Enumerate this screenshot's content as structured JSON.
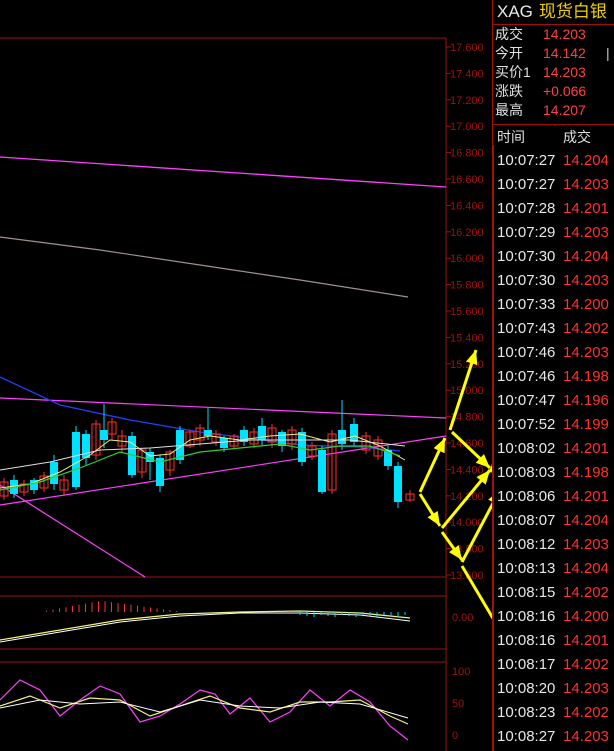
{
  "price_axis": [
    "17.600",
    "17.400",
    "17.200",
    "17.000",
    "16.800",
    "16.600",
    "16.400",
    "16.200",
    "16.000",
    "15.800",
    "15.600",
    "15.400",
    "15.200",
    "15.000",
    "14.800",
    "14.600",
    "14.400",
    "14.200",
    "14.000",
    "13.800",
    "13.600"
  ],
  "volume_axis": [
    "0.00"
  ],
  "indicator_axis": [
    "100",
    "50",
    "0"
  ],
  "colors": {
    "up": "#ff3030",
    "down": "#00e0ff",
    "grid": "#a01010",
    "arrow": "#ffff00",
    "ma_yellow": "#f0f080",
    "ma_green": "#30d030",
    "ma_blue": "#2040ff",
    "magenta": "#ff40ff",
    "axis_text": "#a01010"
  },
  "quote": {
    "symbol_code": "XAG",
    "symbol_name": "现货白银",
    "rows": [
      {
        "label": "成交",
        "value": "14.203",
        "trail": ""
      },
      {
        "label": "今开",
        "value": "14.142",
        "trail": "|"
      },
      {
        "label": "买价1",
        "value": "14.203",
        "trail": ""
      },
      {
        "label": "涨跌",
        "value": "+0.066",
        "trail": ""
      },
      {
        "label": "最高",
        "value": "14.207",
        "trail": ""
      }
    ]
  },
  "ticks": {
    "header_time": "时间",
    "header_price": "成交",
    "rows": [
      {
        "time": "10:07:27",
        "price": "14.204"
      },
      {
        "time": "10:07:27",
        "price": "14.203"
      },
      {
        "time": "10:07:28",
        "price": "14.201"
      },
      {
        "time": "10:07:29",
        "price": "14.203"
      },
      {
        "time": "10:07:30",
        "price": "14.204"
      },
      {
        "time": "10:07:30",
        "price": "14.203"
      },
      {
        "time": "10:07:33",
        "price": "14.200"
      },
      {
        "time": "10:07:43",
        "price": "14.202"
      },
      {
        "time": "10:07:46",
        "price": "14.203"
      },
      {
        "time": "10:07:46",
        "price": "14.198"
      },
      {
        "time": "10:07:47",
        "price": "14.196"
      },
      {
        "time": "10:07:52",
        "price": "14.199"
      },
      {
        "time": "10:08:02",
        "price": "14.201"
      },
      {
        "time": "10:08:03",
        "price": "14.198"
      },
      {
        "time": "10:08:06",
        "price": "14.201"
      },
      {
        "time": "10:08:07",
        "price": "14.204"
      },
      {
        "time": "10:08:12",
        "price": "14.203"
      },
      {
        "time": "10:08:13",
        "price": "14.204"
      },
      {
        "time": "10:08:15",
        "price": "14.202"
      },
      {
        "time": "10:08:16",
        "price": "14.200"
      },
      {
        "time": "10:08:16",
        "price": "14.201"
      },
      {
        "time": "10:08:17",
        "price": "14.202"
      },
      {
        "time": "10:08:20",
        "price": "14.203"
      },
      {
        "time": "10:08:23",
        "price": "14.202"
      },
      {
        "time": "10:08:27",
        "price": "14.203"
      }
    ]
  }
}
